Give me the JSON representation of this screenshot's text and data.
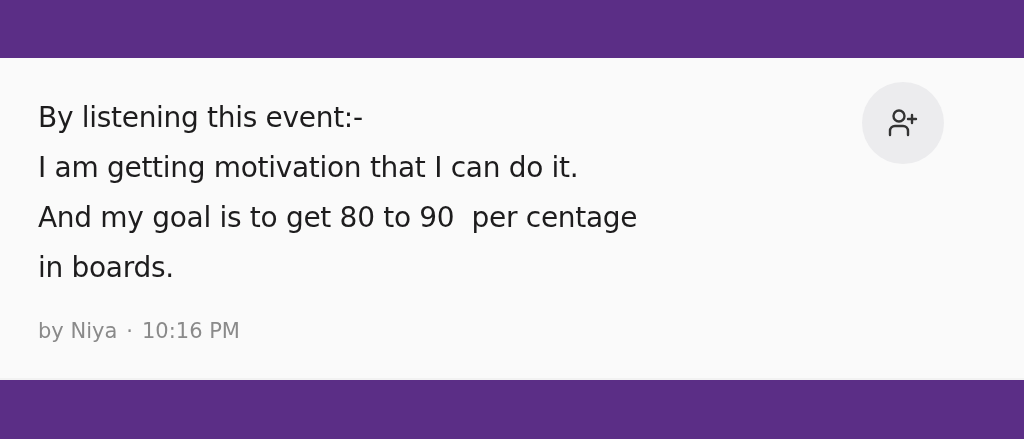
{
  "post": {
    "text": "By listening this event:-\nI am getting motivation that I can do it.\nAnd my goal is to get 80 to 90  per centage\nin boards.",
    "author": "by Niya",
    "separator": "·",
    "time": "10:16 PM"
  }
}
